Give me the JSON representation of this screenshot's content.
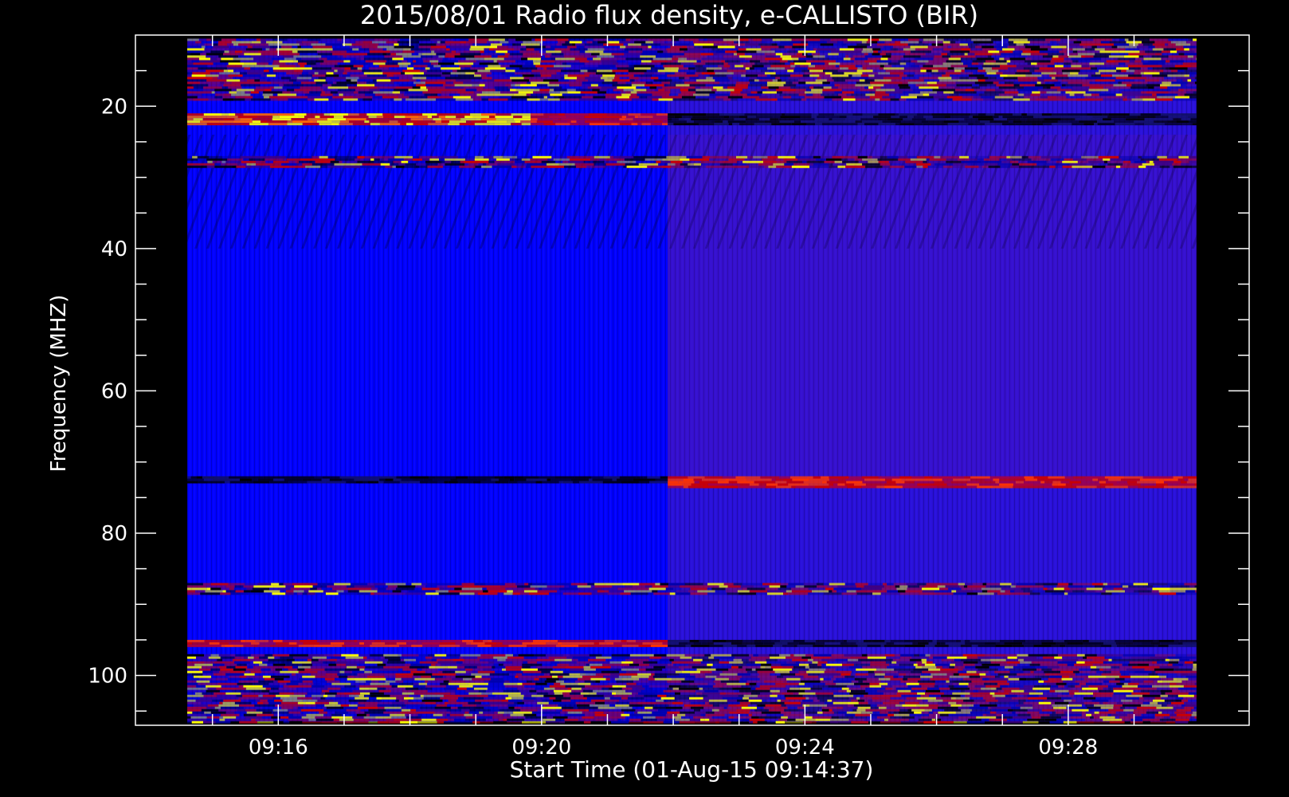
{
  "chart_data": {
    "type": "heatmap",
    "title": "2015/08/01  Radio flux density, e-CALLISTO (BIR)",
    "xlabel": "Start Time (01-Aug-15 09:14:37)",
    "ylabel": "Frequency (MHZ)",
    "x_range": [
      "09:14:37",
      "09:29:57"
    ],
    "x_ticks": [
      "09:16",
      "09:20",
      "09:24",
      "09:28"
    ],
    "ylim": [
      10,
      107
    ],
    "y_inverted": true,
    "y_ticks": [
      20,
      40,
      60,
      80,
      100
    ],
    "time_split": "09:21:55",
    "colors": {
      "background": "#000000",
      "low": "#0000ff",
      "medium": "#cc0000",
      "high": "#ffff00"
    },
    "bands": [
      {
        "f_min": 10.5,
        "f_max": 19,
        "t_start": "09:14:37",
        "t_end": "09:29:57",
        "level": "mixed"
      },
      {
        "f_min": 21,
        "f_max": 22.5,
        "t_start": "09:14:37",
        "t_end": "09:19:50",
        "level": "high"
      },
      {
        "f_min": 21,
        "f_max": 22.5,
        "t_start": "09:19:50",
        "t_end": "09:21:55",
        "level": "medium"
      },
      {
        "f_min": 21,
        "f_max": 22.5,
        "t_start": "09:21:55",
        "t_end": "09:29:57",
        "level": "dark"
      },
      {
        "f_min": 27,
        "f_max": 28.5,
        "t_start": "09:14:37",
        "t_end": "09:29:57",
        "level": "mixed"
      },
      {
        "f_min": 72,
        "f_max": 73,
        "t_start": "09:14:37",
        "t_end": "09:21:55",
        "level": "dark"
      },
      {
        "f_min": 72,
        "f_max": 73.5,
        "t_start": "09:21:55",
        "t_end": "09:29:57",
        "level": "medium"
      },
      {
        "f_min": 87,
        "f_max": 88.5,
        "t_start": "09:14:37",
        "t_end": "09:29:57",
        "level": "mixed"
      },
      {
        "f_min": 95,
        "f_max": 96,
        "t_start": "09:14:37",
        "t_end": "09:21:55",
        "level": "medium"
      },
      {
        "f_min": 95,
        "f_max": 96,
        "t_start": "09:21:55",
        "t_end": "09:29:57",
        "level": "dark"
      },
      {
        "f_min": 97,
        "f_max": 106.5,
        "t_start": "09:14:37",
        "t_end": "09:29:57",
        "level": "mixed"
      }
    ]
  }
}
